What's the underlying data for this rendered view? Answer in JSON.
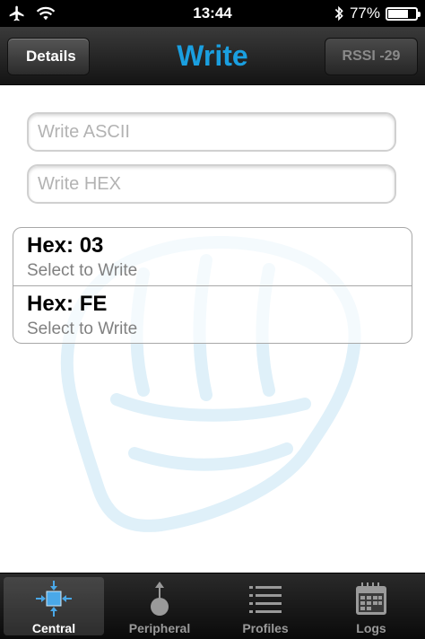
{
  "statusbar": {
    "time": "13:44",
    "battery": "77%",
    "battery_level": 0.77
  },
  "navbar": {
    "back_label": "Details",
    "title": "Write",
    "rssi_label": "RSSI -29"
  },
  "inputs": {
    "ascii_placeholder": "Write ASCII",
    "hex_placeholder": "Write HEX"
  },
  "list": [
    {
      "title": "Hex: 03",
      "subtitle": "Select to Write"
    },
    {
      "title": "Hex: FE",
      "subtitle": "Select to Write"
    }
  ],
  "tabs": [
    {
      "label": "Central",
      "icon": "central-icon"
    },
    {
      "label": "Peripheral",
      "icon": "peripheral-icon"
    },
    {
      "label": "Profiles",
      "icon": "list-icon"
    },
    {
      "label": "Logs",
      "icon": "calendar-icon"
    }
  ],
  "colors": {
    "accent": "#1a9fe0",
    "watermark": "#dff0f9"
  }
}
